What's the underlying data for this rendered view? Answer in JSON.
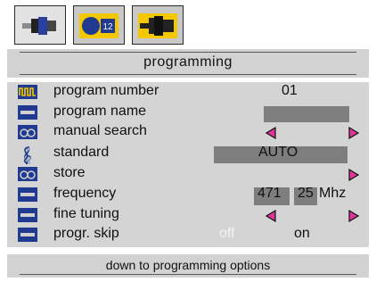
{
  "tabs": [
    {
      "icon": "scart-connector-icon"
    },
    {
      "icon": "tv-channel-icon",
      "badge": "12"
    },
    {
      "icon": "connector-icon"
    }
  ],
  "title": "programming",
  "rows": [
    {
      "label": "program number",
      "icon": "waveform-icon",
      "value": "01"
    },
    {
      "label": "program name",
      "icon": "keyboard-icon",
      "value": ""
    },
    {
      "label": "manual search",
      "icon": "search-eyes-icon"
    },
    {
      "label": "standard",
      "icon": "clef-icon",
      "value": "AUTO"
    },
    {
      "label": "store",
      "icon": "search-eyes-icon"
    },
    {
      "label": "frequency",
      "icon": "keyboard-icon",
      "value_main": "471",
      "value_sub": "25",
      "unit": "Mhz"
    },
    {
      "label": "fine tuning",
      "icon": "keyboard-icon"
    },
    {
      "label": "progr. skip",
      "icon": "keyboard-icon",
      "off": "off",
      "on": "on"
    }
  ],
  "footer": "down to programming options",
  "colors": {
    "accent_arrow": "#e0349a",
    "icon_bg": "#1f3a8e",
    "tab_yellow": "#f3c800"
  }
}
